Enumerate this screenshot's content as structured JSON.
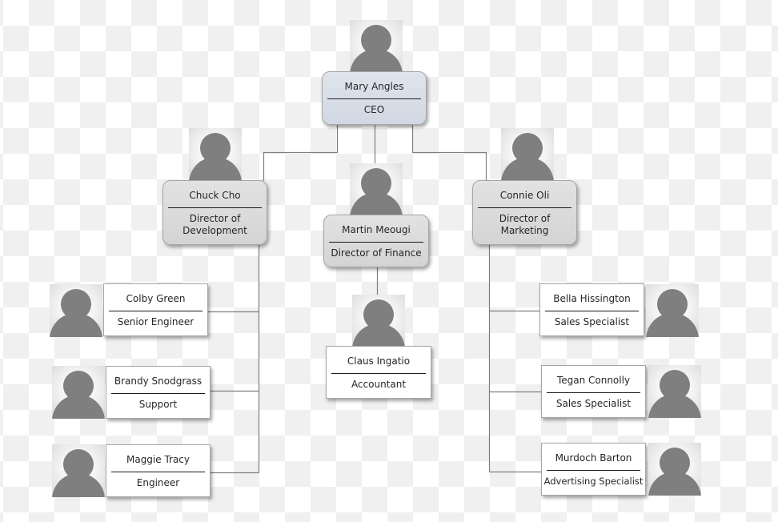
{
  "chart": {
    "title": "",
    "ceo": {
      "name": "Mary Angles",
      "title": "CEO",
      "avatar_icon": "person-silhouette-icon"
    },
    "directors": [
      {
        "key": "development",
        "name": "Chuck Cho",
        "title": "Director of Development",
        "title_lines": [
          "Director of",
          "Development"
        ],
        "avatar_icon": "person-silhouette-icon"
      },
      {
        "key": "finance",
        "name": "Martin Meougi",
        "title": "Director of Finance",
        "title_lines": [
          "Director of Finance"
        ],
        "avatar_icon": "person-silhouette-icon"
      },
      {
        "key": "marketing",
        "name": "Connie Oli",
        "title": "Director of Marketing",
        "title_lines": [
          "Director of",
          "Marketing"
        ],
        "avatar_icon": "person-silhouette-icon"
      }
    ],
    "development_team": [
      {
        "name": "Colby Green",
        "title": "Senior Engineer",
        "reports_to": "Chuck Cho"
      },
      {
        "name": "Brandy Snodgrass",
        "title": "Support",
        "reports_to": "Chuck Cho"
      },
      {
        "name": "Maggie Tracy",
        "title": "Engineer",
        "reports_to": "Chuck Cho"
      }
    ],
    "finance_team": [
      {
        "name": "Claus Ingatio",
        "title": "Accountant",
        "reports_to": "Martin Meougi"
      }
    ],
    "marketing_team": [
      {
        "name": "Bella Hissington",
        "title": "Sales Specialist",
        "reports_to": "Connie Oli"
      },
      {
        "name": "Tegan Connolly",
        "title": "Sales Specialist",
        "reports_to": "Connie Oli"
      },
      {
        "name": "Murdoch Barton",
        "title": "Advertising Specialist",
        "reports_to": "Connie Oli"
      }
    ]
  },
  "colors": {
    "ceo_fill": "#d6dce6",
    "director_fill": "#d9d9d9",
    "employee_fill": "#ffffff",
    "connector": "#7f7f7f",
    "silhouette": "#7f7f7f",
    "checker_light": "#ffffff",
    "checker_dark": "#f0f0f0"
  }
}
